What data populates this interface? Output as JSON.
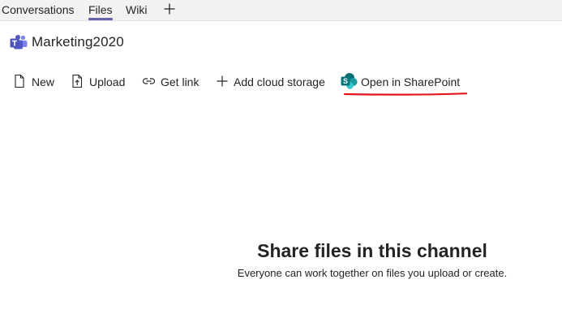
{
  "tabs": [
    {
      "label": "Conversations",
      "active": false
    },
    {
      "label": "Files",
      "active": true
    },
    {
      "label": "Wiki",
      "active": false
    }
  ],
  "add_tab_icon": "plus-icon",
  "channel": {
    "icon": "teams-logo-icon",
    "name": "Marketing2020"
  },
  "toolbar": {
    "new": {
      "label": "New",
      "icon": "new-document-icon"
    },
    "upload": {
      "label": "Upload",
      "icon": "upload-icon"
    },
    "get_link": {
      "label": "Get link",
      "icon": "link-icon"
    },
    "add_cloud": {
      "label": "Add cloud storage",
      "icon": "plus-icon"
    },
    "open_sp": {
      "label": "Open in SharePoint",
      "icon": "sharepoint-icon"
    }
  },
  "annotation": {
    "color": "#e3161f"
  },
  "empty_state": {
    "title": "Share files in this channel",
    "subtitle": "Everyone can work together on files you upload or create."
  },
  "colors": {
    "accent": "#6264a7",
    "sharepoint": "#036c70"
  }
}
